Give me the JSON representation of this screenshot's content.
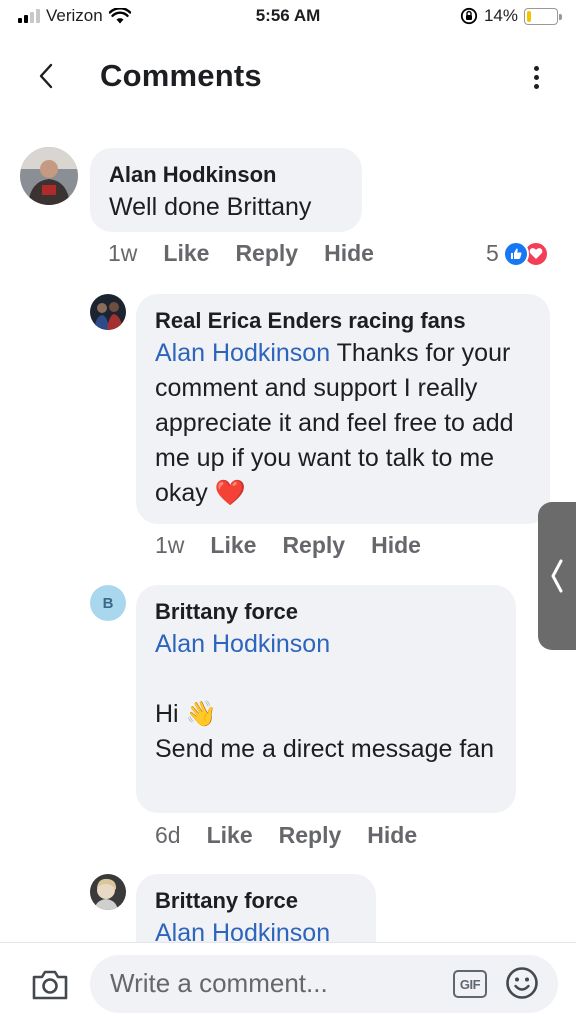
{
  "status_bar": {
    "carrier": "Verizon",
    "time": "5:56 AM",
    "battery_percent": "14%",
    "battery_level": 0.14
  },
  "header": {
    "title": "Comments",
    "back_icon": "chevron-left-icon",
    "more_icon": "more-vertical-icon"
  },
  "comments": [
    {
      "author": "Alan Hodkinson",
      "text": "Well done Brittany",
      "time": "1w",
      "like": "Like",
      "reply": "Reply",
      "hide": "Hide",
      "reaction_count": "5"
    },
    {
      "author": "Real Erica Enders racing fans",
      "mention": "Alan Hodkinson",
      "text": " Thanks for your comment and support I really appreciate it and feel free to add me up if you want to talk to me okay ❤️",
      "time": "1w",
      "like": "Like",
      "reply": "Reply",
      "hide": "Hide"
    },
    {
      "author": "Brittany force",
      "mention": "Alan Hodkinson",
      "avatar_initial": "B",
      "line1": "Hi 👋",
      "line2": "Send me a direct message fan",
      "time": "6d",
      "like": "Like",
      "reply": "Reply",
      "hide": "Hide"
    },
    {
      "author": "Brittany force",
      "mention": "Alan Hodkinson"
    }
  ],
  "composer": {
    "placeholder": "Write a comment...",
    "gif_label": "GIF"
  },
  "colors": {
    "bubble": "#f0f2f5",
    "mention": "#2d64bc",
    "like_blue": "#1877f2",
    "love_red": "#f33e58",
    "battery_yellow": "#f5c400"
  }
}
